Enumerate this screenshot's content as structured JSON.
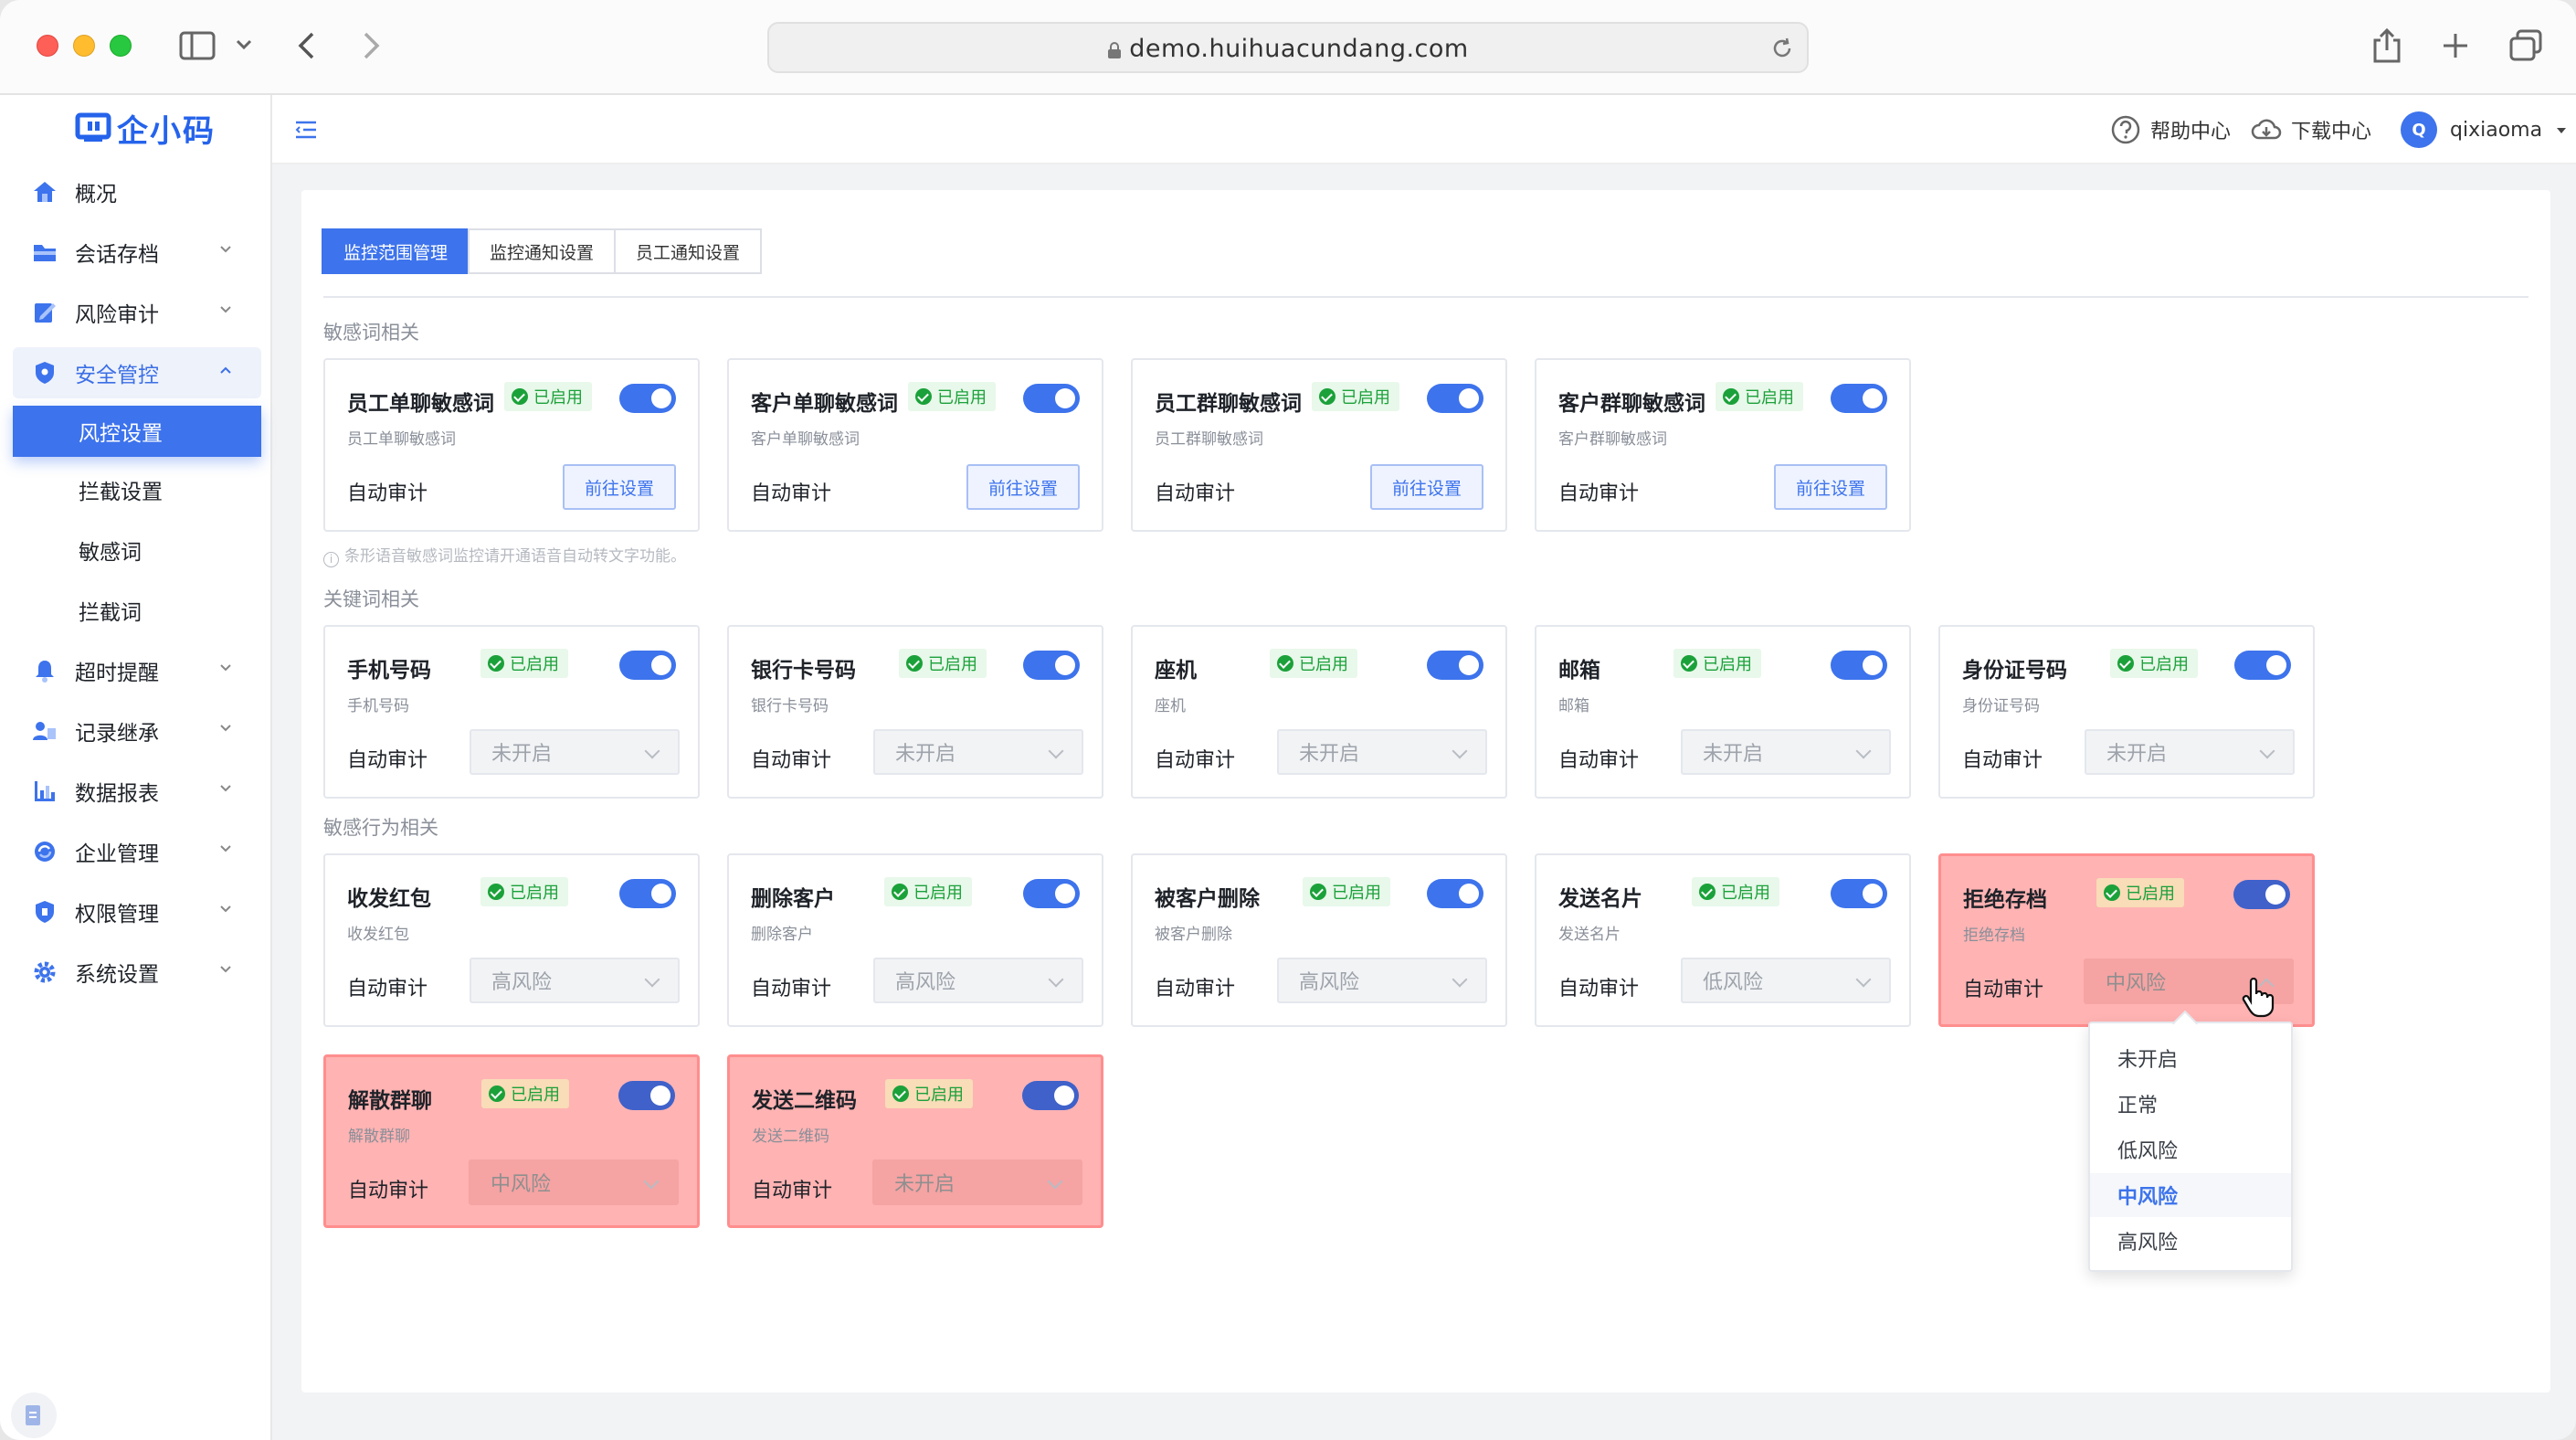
{
  "browser": {
    "url": "demo.huihuacundang.com"
  },
  "logo": {
    "text": "企小码"
  },
  "sidebar": {
    "items": [
      {
        "label": "概况",
        "icon": "home-icon"
      },
      {
        "label": "会话存档",
        "icon": "folder-icon"
      },
      {
        "label": "风险审计",
        "icon": "audit-icon"
      },
      {
        "label": "安全管控",
        "icon": "shield-icon"
      },
      {
        "label": "超时提醒",
        "icon": "bell-icon"
      },
      {
        "label": "记录继承",
        "icon": "inherit-icon"
      },
      {
        "label": "数据报表",
        "icon": "chart-icon"
      },
      {
        "label": "企业管理",
        "icon": "org-icon"
      },
      {
        "label": "权限管理",
        "icon": "permission-icon"
      },
      {
        "label": "系统设置",
        "icon": "gear-icon"
      }
    ],
    "subitems": [
      "风控设置",
      "拦截设置",
      "敏感词",
      "拦截词"
    ]
  },
  "topbar": {
    "help": "帮助中心",
    "download": "下载中心",
    "avatar_letter": "Q",
    "username": "qixiaoma"
  },
  "tabs": [
    "监控范围管理",
    "监控通知设置",
    "员工通知设置"
  ],
  "sections": {
    "sensitive_words": "敏感词相关",
    "keywords": "关键词相关",
    "behaviors": "敏感行为相关"
  },
  "hint": "条形语音敏感词监控请开通语音自动转文字功能。",
  "common": {
    "enabled": "已启用",
    "auto_audit": "自动审计",
    "go_setting": "前往设置"
  },
  "sensitive_cards": [
    {
      "title": "员工单聊敏感词",
      "sub": "员工单聊敏感词"
    },
    {
      "title": "客户单聊敏感词",
      "sub": "客户单聊敏感词"
    },
    {
      "title": "员工群聊敏感词",
      "sub": "员工群聊敏感词"
    },
    {
      "title": "客户群聊敏感词",
      "sub": "客户群聊敏感词"
    }
  ],
  "keyword_cards": [
    {
      "title": "手机号码",
      "sub": "手机号码",
      "value": "未开启"
    },
    {
      "title": "银行卡号码",
      "sub": "银行卡号码",
      "value": "未开启"
    },
    {
      "title": "座机",
      "sub": "座机",
      "value": "未开启"
    },
    {
      "title": "邮箱",
      "sub": "邮箱",
      "value": "未开启"
    },
    {
      "title": "身份证号码",
      "sub": "身份证号码",
      "value": "未开启"
    }
  ],
  "behavior_cards": [
    {
      "title": "收发红包",
      "sub": "收发红包",
      "value": "高风险"
    },
    {
      "title": "删除客户",
      "sub": "删除客户",
      "value": "高风险"
    },
    {
      "title": "被客户删除",
      "sub": "被客户删除",
      "value": "高风险"
    },
    {
      "title": "发送名片",
      "sub": "发送名片",
      "value": "低风险"
    },
    {
      "title": "拒绝存档",
      "sub": "拒绝存档",
      "value": "中风险"
    },
    {
      "title": "解散群聊",
      "sub": "解散群聊",
      "value": "中风险"
    },
    {
      "title": "发送二维码",
      "sub": "发送二维码",
      "value": "未开启"
    }
  ],
  "dropdown": {
    "options": [
      "未开启",
      "正常",
      "低风险",
      "中风险",
      "高风险"
    ],
    "selected": "中风险"
  }
}
